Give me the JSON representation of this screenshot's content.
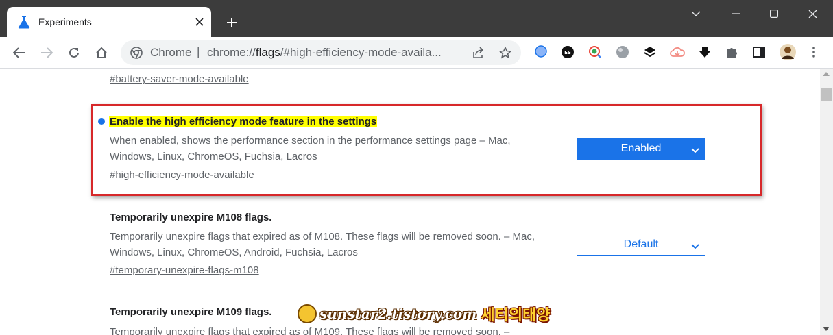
{
  "tab": {
    "title": "Experiments"
  },
  "omnibox": {
    "site_label": "Chrome",
    "separator": "|",
    "url_prefix": "chrome://",
    "url_bold": "flags",
    "url_rest": "/#high-efficiency-mode-availa..."
  },
  "extensions": {
    "badge_count": "0",
    "es_label": "ES"
  },
  "flags": [
    {
      "link": "#battery-saver-mode-available"
    },
    {
      "title": "Enable the high efficiency mode feature in the settings",
      "description": "When enabled, shows the performance section in the performance settings page – Mac, Windows, Linux, ChromeOS, Fuchsia, Lacros",
      "link": "#high-efficiency-mode-available",
      "state": "Enabled",
      "highlighted": true
    },
    {
      "title": "Temporarily unexpire M108 flags.",
      "description": "Temporarily unexpire flags that expired as of M108. These flags will be removed soon. – Mac, Windows, Linux, ChromeOS, Android, Fuchsia, Lacros",
      "link": "#temporary-unexpire-flags-m108",
      "state": "Default"
    },
    {
      "title": "Temporarily unexpire M109 flags.",
      "description": "Temporarily unexpire flags that expired as of M109. These flags will be removed soon. –"
    }
  ],
  "watermark": {
    "text": "sunstar2.tistory.com",
    "korean": "세티의태양"
  },
  "colors": {
    "accent": "#1a73e8",
    "highlight": "#ffff00",
    "annotation_box": "#d7282a",
    "titlebar": "#3c3c3c"
  }
}
